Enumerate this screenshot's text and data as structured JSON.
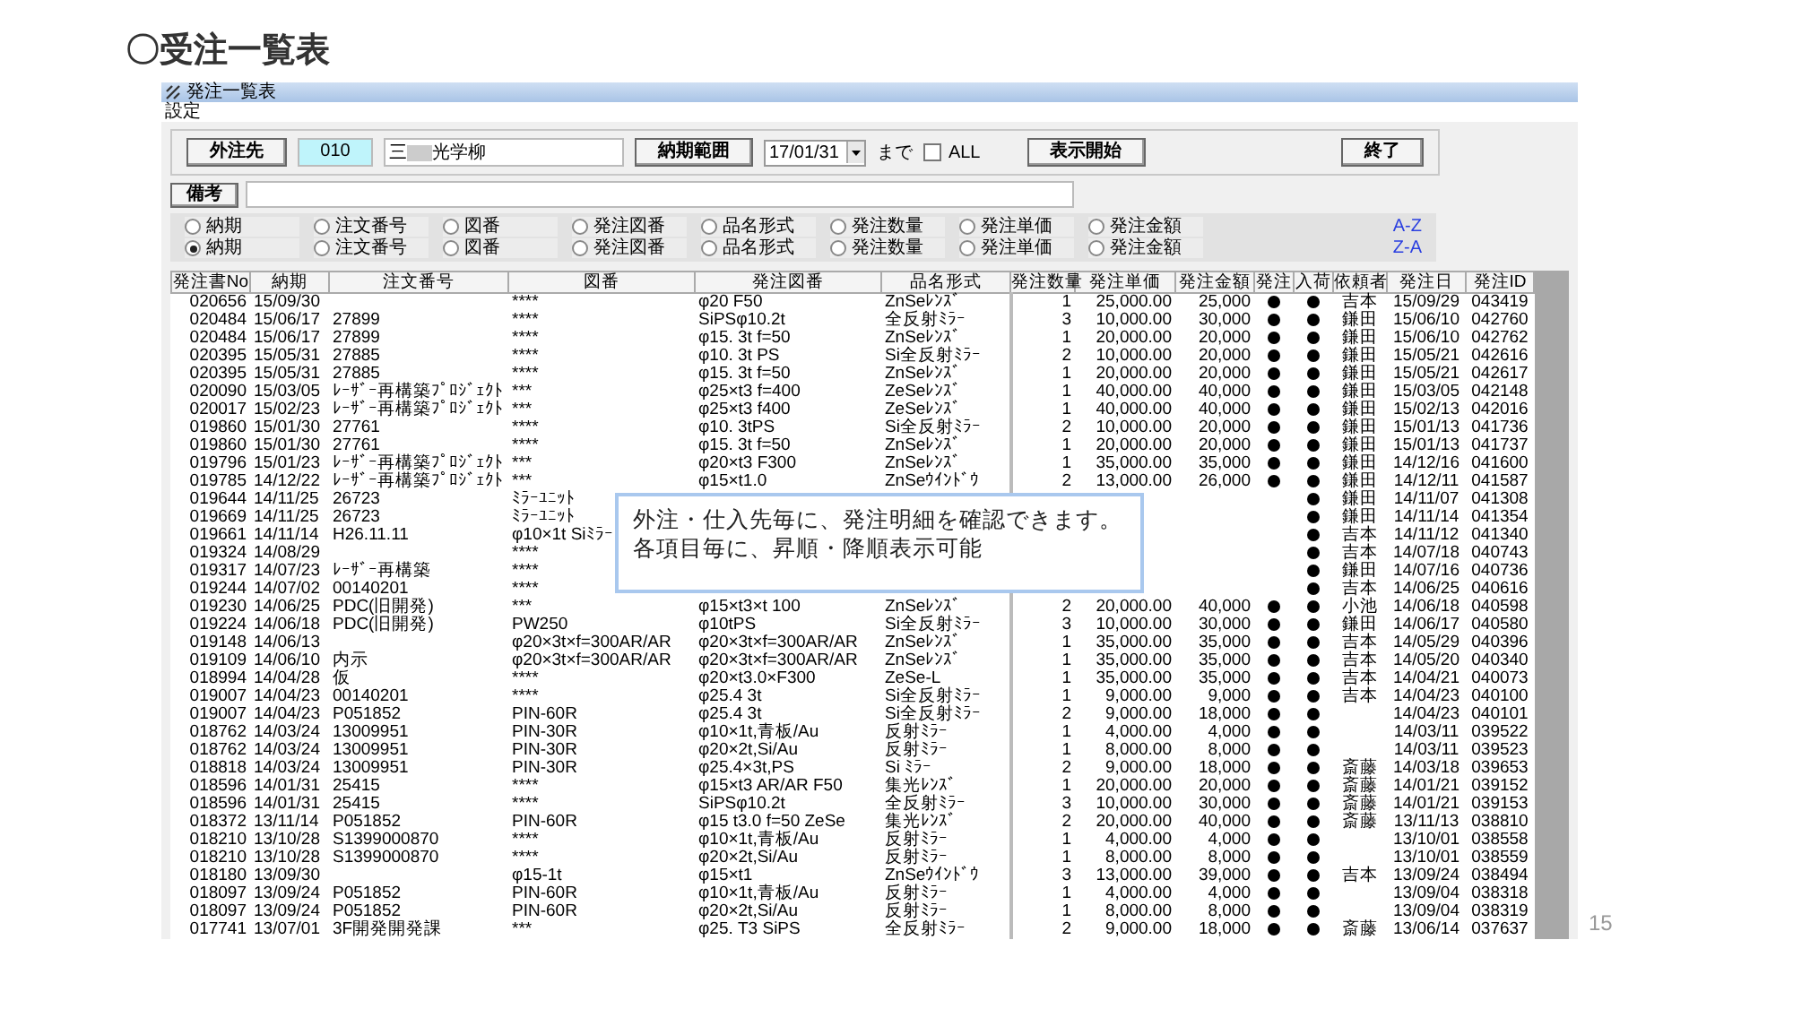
{
  "slide": {
    "title": "〇受注一覧表",
    "page_number": "15"
  },
  "window": {
    "title": "発注一覧表",
    "menu": [
      "設定"
    ]
  },
  "filter": {
    "supplier_button": "外注先",
    "supplier_code": "010",
    "supplier_name_start": "三",
    "supplier_name_end": "光学柳",
    "due_button": "納期範囲",
    "due_date": "17/01/31",
    "due_suffix": "まで",
    "all_checkbox": {
      "label": "ALL",
      "checked": false
    },
    "show_button": "表示開始",
    "exit_button": "終了"
  },
  "remarks": {
    "label": "備考"
  },
  "sort_rows": [
    {
      "order": "A-Z",
      "options": [
        {
          "label": "納期",
          "selected": false
        },
        {
          "label": "注文番号",
          "selected": false
        },
        {
          "label": "図番",
          "selected": false
        },
        {
          "label": "発注図番",
          "selected": false
        },
        {
          "label": "品名形式",
          "selected": false
        },
        {
          "label": "発注数量",
          "selected": false
        },
        {
          "label": "発注単価",
          "selected": false
        },
        {
          "label": "発注金額",
          "selected": false
        }
      ]
    },
    {
      "order": "Z-A",
      "options": [
        {
          "label": "納期",
          "selected": true
        },
        {
          "label": "注文番号",
          "selected": false
        },
        {
          "label": "図番",
          "selected": false
        },
        {
          "label": "発注図番",
          "selected": false
        },
        {
          "label": "品名形式",
          "selected": false
        },
        {
          "label": "発注数量",
          "selected": false
        },
        {
          "label": "発注単価",
          "selected": false
        },
        {
          "label": "発注金額",
          "selected": false
        }
      ]
    }
  ],
  "table": {
    "columns": [
      "発注書No",
      "納期",
      "注文番号",
      "図番",
      "発注図番",
      "品名形式",
      "発注数量",
      "発注単価",
      "発注金額",
      "発注",
      "入荷",
      "依頼者",
      "発注日",
      "発注ID"
    ],
    "rows": [
      {
        "no": "020656",
        "due": "15/09/30",
        "drawing": "****",
        "order_drawing": "φ20 F50",
        "product": "ZnSeﾚﾝｽﾞ",
        "qty": "1",
        "unit_price": "25,000.00",
        "amount": "25,000",
        "ordered": true,
        "received": true,
        "requester": "吉本",
        "order_date": "15/09/29",
        "order_id": "043419"
      },
      {
        "no": "020484",
        "due": "15/06/17",
        "order_no": "27899",
        "drawing": "****",
        "order_drawing": "SiPSφ10.2t",
        "product": "全反射ﾐﾗｰ",
        "qty": "3",
        "unit_price": "10,000.00",
        "amount": "30,000",
        "ordered": true,
        "received": true,
        "requester": "鎌田",
        "order_date": "15/06/10",
        "order_id": "042760"
      },
      {
        "no": "020484",
        "due": "15/06/17",
        "order_no": "27899",
        "drawing": "****",
        "order_drawing": "φ15. 3t f=50",
        "product": "ZnSeﾚﾝｽﾞ",
        "qty": "1",
        "unit_price": "20,000.00",
        "amount": "20,000",
        "ordered": true,
        "received": true,
        "requester": "鎌田",
        "order_date": "15/06/10",
        "order_id": "042762"
      },
      {
        "no": "020395",
        "due": "15/05/31",
        "order_no": "27885",
        "drawing": "****",
        "order_drawing": "φ10. 3t PS",
        "product": "Si全反射ﾐﾗｰ",
        "qty": "2",
        "unit_price": "10,000.00",
        "amount": "20,000",
        "ordered": true,
        "received": true,
        "requester": "鎌田",
        "order_date": "15/05/21",
        "order_id": "042616"
      },
      {
        "no": "020395",
        "due": "15/05/31",
        "order_no": "27885",
        "drawing": "****",
        "order_drawing": "φ15. 3t f=50",
        "product": "ZnSeﾚﾝｽﾞ",
        "qty": "1",
        "unit_price": "20,000.00",
        "amount": "20,000",
        "ordered": true,
        "received": true,
        "requester": "鎌田",
        "order_date": "15/05/21",
        "order_id": "042617"
      },
      {
        "no": "020090",
        "due": "15/03/05",
        "order_no": "ﾚｰｻﾞｰ再構築ﾌﾟﾛｼﾞｪｸﾄ",
        "drawing": "***",
        "order_drawing": "φ25×t3 f=400",
        "product": "ZeSeﾚﾝｽﾞ",
        "qty": "1",
        "unit_price": "40,000.00",
        "amount": "40,000",
        "ordered": true,
        "received": true,
        "requester": "鎌田",
        "order_date": "15/03/05",
        "order_id": "042148"
      },
      {
        "no": "020017",
        "due": "15/02/23",
        "order_no": "ﾚｰｻﾞｰ再構築ﾌﾟﾛｼﾞｪｸﾄ",
        "drawing": "***",
        "order_drawing": "φ25×t3 f400",
        "product": "ZeSeﾚﾝｽﾞ",
        "qty": "1",
        "unit_price": "40,000.00",
        "amount": "40,000",
        "ordered": true,
        "received": true,
        "requester": "鎌田",
        "order_date": "15/02/13",
        "order_id": "042016"
      },
      {
        "no": "019860",
        "due": "15/01/30",
        "order_no": "27761",
        "drawing": "****",
        "order_drawing": "φ10. 3tPS",
        "product": "Si全反射ﾐﾗｰ",
        "qty": "2",
        "unit_price": "10,000.00",
        "amount": "20,000",
        "ordered": true,
        "received": true,
        "requester": "鎌田",
        "order_date": "15/01/13",
        "order_id": "041736"
      },
      {
        "no": "019860",
        "due": "15/01/30",
        "order_no": "27761",
        "drawing": "****",
        "order_drawing": "φ15. 3t f=50",
        "product": "ZnSeﾚﾝｽﾞ",
        "qty": "1",
        "unit_price": "20,000.00",
        "amount": "20,000",
        "ordered": true,
        "received": true,
        "requester": "鎌田",
        "order_date": "15/01/13",
        "order_id": "041737"
      },
      {
        "no": "019796",
        "due": "15/01/23",
        "order_no": "ﾚｰｻﾞｰ再構築ﾌﾟﾛｼﾞｪｸﾄ",
        "drawing": "***",
        "order_drawing": "φ20×t3 F300",
        "product": "ZnSeﾚﾝｽﾞ",
        "qty": "1",
        "unit_price": "35,000.00",
        "amount": "35,000",
        "ordered": true,
        "received": true,
        "requester": "鎌田",
        "order_date": "14/12/16",
        "order_id": "041600"
      },
      {
        "no": "019785",
        "due": "14/12/22",
        "order_no": "ﾚｰｻﾞｰ再構築ﾌﾟﾛｼﾞｪｸﾄ",
        "drawing": "***",
        "order_drawing": "φ15×t1.0",
        "product": "ZnSeｳｲﾝﾄﾞｳ",
        "qty": "2",
        "unit_price": "13,000.00",
        "amount": "26,000",
        "ordered": true,
        "received": true,
        "requester": "鎌田",
        "order_date": "14/12/11",
        "order_id": "041587"
      },
      {
        "no": "019644",
        "due": "14/11/25",
        "order_no": "26723",
        "drawing": "ﾐﾗｰﾕﾆｯﾄ",
        "received": true,
        "requester": "鎌田",
        "order_date": "14/11/07",
        "order_id": "041308"
      },
      {
        "no": "019669",
        "due": "14/11/25",
        "order_no": "26723",
        "drawing": "ﾐﾗｰﾕﾆｯﾄ",
        "received": true,
        "requester": "鎌田",
        "order_date": "14/11/14",
        "order_id": "041354"
      },
      {
        "no": "019661",
        "due": "14/11/14",
        "order_no": "H26.11.11",
        "drawing": "φ10×1t Siﾐﾗｰ",
        "received": true,
        "requester": "吉本",
        "order_date": "14/11/12",
        "order_id": "041340"
      },
      {
        "no": "019324",
        "due": "14/08/29",
        "drawing": "****",
        "received": true,
        "requester": "吉本",
        "order_date": "14/07/18",
        "order_id": "040743"
      },
      {
        "no": "019317",
        "due": "14/07/23",
        "order_no": "ﾚｰｻﾞｰ再構築",
        "drawing": "****",
        "received": true,
        "requester": "鎌田",
        "order_date": "14/07/16",
        "order_id": "040736"
      },
      {
        "no": "019244",
        "due": "14/07/02",
        "order_no": "00140201",
        "drawing": "****",
        "received": true,
        "requester": "吉本",
        "order_date": "14/06/25",
        "order_id": "040616"
      },
      {
        "no": "019230",
        "due": "14/06/25",
        "order_no": "PDC(旧開発)",
        "drawing": "***",
        "order_drawing": "φ15×t3×t 100",
        "product": "ZnSeﾚﾝｽﾞ",
        "qty": "2",
        "unit_price": "20,000.00",
        "amount": "40,000",
        "ordered": true,
        "received": true,
        "requester": "小池",
        "order_date": "14/06/18",
        "order_id": "040598"
      },
      {
        "no": "019224",
        "due": "14/06/18",
        "order_no": "PDC(旧開発)",
        "drawing": "PW250",
        "order_drawing": "φ10tPS",
        "product": "Si全反射ﾐﾗｰ",
        "qty": "3",
        "unit_price": "10,000.00",
        "amount": "30,000",
        "ordered": true,
        "received": true,
        "requester": "鎌田",
        "order_date": "14/06/17",
        "order_id": "040580"
      },
      {
        "no": "019148",
        "due": "14/06/13",
        "drawing": "φ20×3t×f=300AR/AR",
        "order_drawing": "φ20×3t×f=300AR/AR",
        "product": "ZnSeﾚﾝｽﾞ",
        "qty": "1",
        "unit_price": "35,000.00",
        "amount": "35,000",
        "ordered": true,
        "received": true,
        "requester": "吉本",
        "order_date": "14/05/29",
        "order_id": "040396"
      },
      {
        "no": "019109",
        "due": "14/06/10",
        "order_no": "内示",
        "drawing": "φ20×3t×f=300AR/AR",
        "order_drawing": "φ20×3t×f=300AR/AR",
        "product": "ZnSeﾚﾝｽﾞ",
        "qty": "1",
        "unit_price": "35,000.00",
        "amount": "35,000",
        "ordered": true,
        "received": true,
        "requester": "吉本",
        "order_date": "14/05/20",
        "order_id": "040340"
      },
      {
        "no": "018994",
        "due": "14/04/28",
        "order_no": "仮",
        "drawing": "****",
        "order_drawing": "φ20×t3.0×F300",
        "product": "ZeSe-L",
        "qty": "1",
        "unit_price": "35,000.00",
        "amount": "35,000",
        "ordered": true,
        "received": true,
        "requester": "吉本",
        "order_date": "14/04/21",
        "order_id": "040073"
      },
      {
        "no": "019007",
        "due": "14/04/23",
        "order_no": "00140201",
        "drawing": "****",
        "order_drawing": "φ25.4 3t",
        "product": "Si全反射ﾐﾗｰ",
        "qty": "1",
        "unit_price": "9,000.00",
        "amount": "9,000",
        "ordered": true,
        "received": true,
        "requester": "吉本",
        "order_date": "14/04/23",
        "order_id": "040100"
      },
      {
        "no": "019007",
        "due": "14/04/23",
        "order_no": "P051852",
        "drawing": "PIN-60R",
        "order_drawing": "φ25.4 3t",
        "product": "Si全反射ﾐﾗｰ",
        "qty": "2",
        "unit_price": "9,000.00",
        "amount": "18,000",
        "ordered": true,
        "received": true,
        "order_date": "14/04/23",
        "order_id": "040101"
      },
      {
        "no": "018762",
        "due": "14/03/24",
        "order_no": "13009951",
        "drawing": "PIN-30R",
        "order_drawing": "φ10×1t,青板/Au",
        "product": "反射ﾐﾗｰ",
        "qty": "1",
        "unit_price": "4,000.00",
        "amount": "4,000",
        "ordered": true,
        "received": true,
        "order_date": "14/03/11",
        "order_id": "039522"
      },
      {
        "no": "018762",
        "due": "14/03/24",
        "order_no": "13009951",
        "drawing": "PIN-30R",
        "order_drawing": "φ20×2t,Si/Au",
        "product": "反射ﾐﾗｰ",
        "qty": "1",
        "unit_price": "8,000.00",
        "amount": "8,000",
        "ordered": true,
        "received": true,
        "order_date": "14/03/11",
        "order_id": "039523"
      },
      {
        "no": "018818",
        "due": "14/03/24",
        "order_no": "13009951",
        "drawing": "PIN-30R",
        "order_drawing": "φ25.4×3t,PS",
        "product": "Si ﾐﾗｰ",
        "qty": "2",
        "unit_price": "9,000.00",
        "amount": "18,000",
        "ordered": true,
        "received": true,
        "requester": "斎藤",
        "order_date": "14/03/18",
        "order_id": "039653"
      },
      {
        "no": "018596",
        "due": "14/01/31",
        "order_no": "25415",
        "drawing": "****",
        "order_drawing": "φ15×t3 AR/AR F50",
        "product": "集光ﾚﾝｽﾞ",
        "qty": "1",
        "unit_price": "20,000.00",
        "amount": "20,000",
        "ordered": true,
        "received": true,
        "requester": "斎藤",
        "order_date": "14/01/21",
        "order_id": "039152"
      },
      {
        "no": "018596",
        "due": "14/01/31",
        "order_no": "25415",
        "drawing": "****",
        "order_drawing": "SiPSφ10.2t",
        "product": "全反射ﾐﾗｰ",
        "qty": "3",
        "unit_price": "10,000.00",
        "amount": "30,000",
        "ordered": true,
        "received": true,
        "requester": "斎藤",
        "order_date": "14/01/21",
        "order_id": "039153"
      },
      {
        "no": "018372",
        "due": "13/11/14",
        "order_no": "P051852",
        "drawing": "PIN-60R",
        "order_drawing": "φ15 t3.0 f=50 ZeSe",
        "product": "集光ﾚﾝｽﾞ",
        "qty": "2",
        "unit_price": "20,000.00",
        "amount": "40,000",
        "ordered": true,
        "received": true,
        "requester": "斎藤",
        "order_date": "13/11/13",
        "order_id": "038810"
      },
      {
        "no": "018210",
        "due": "13/10/28",
        "order_no": "S1399000870",
        "drawing": "****",
        "order_drawing": "φ10×1t,青板/Au",
        "product": "反射ﾐﾗｰ",
        "qty": "1",
        "unit_price": "4,000.00",
        "amount": "4,000",
        "ordered": true,
        "received": true,
        "order_date": "13/10/01",
        "order_id": "038558"
      },
      {
        "no": "018210",
        "due": "13/10/28",
        "order_no": "S1399000870",
        "drawing": "****",
        "order_drawing": "φ20×2t,Si/Au",
        "product": "反射ﾐﾗｰ",
        "qty": "1",
        "unit_price": "8,000.00",
        "amount": "8,000",
        "ordered": true,
        "received": true,
        "order_date": "13/10/01",
        "order_id": "038559"
      },
      {
        "no": "018180",
        "due": "13/09/30",
        "drawing": "φ15-1t",
        "order_drawing": "φ15×t1",
        "product": "ZnSeｳｲﾝﾄﾞｳ",
        "qty": "3",
        "unit_price": "13,000.00",
        "amount": "39,000",
        "ordered": true,
        "received": true,
        "requester": "吉本",
        "order_date": "13/09/24",
        "order_id": "038494"
      },
      {
        "no": "018097",
        "due": "13/09/24",
        "order_no": "P051852",
        "drawing": "PIN-60R",
        "order_drawing": "φ10×1t,青板/Au",
        "product": "反射ﾐﾗｰ",
        "qty": "1",
        "unit_price": "4,000.00",
        "amount": "4,000",
        "ordered": true,
        "received": true,
        "order_date": "13/09/04",
        "order_id": "038318"
      },
      {
        "no": "018097",
        "due": "13/09/24",
        "order_no": "P051852",
        "drawing": "PIN-60R",
        "order_drawing": "φ20×2t,Si/Au",
        "product": "反射ﾐﾗｰ",
        "qty": "1",
        "unit_price": "8,000.00",
        "amount": "8,000",
        "ordered": true,
        "received": true,
        "order_date": "13/09/04",
        "order_id": "038319"
      },
      {
        "no": "017741",
        "due": "13/07/01",
        "order_no": "3F開発開発課",
        "drawing": "***",
        "order_drawing": "φ25. T3 SiPS",
        "product": "全反射ﾐﾗｰ",
        "qty": "2",
        "unit_price": "9,000.00",
        "amount": "18,000",
        "ordered": true,
        "received": true,
        "requester": "斎藤",
        "order_date": "13/06/14",
        "order_id": "037637"
      }
    ]
  },
  "callout": {
    "lines": [
      "外注・仕入先毎に、発注明細を確認できます。",
      "各項目毎に、昇順・降順表示可能"
    ]
  }
}
